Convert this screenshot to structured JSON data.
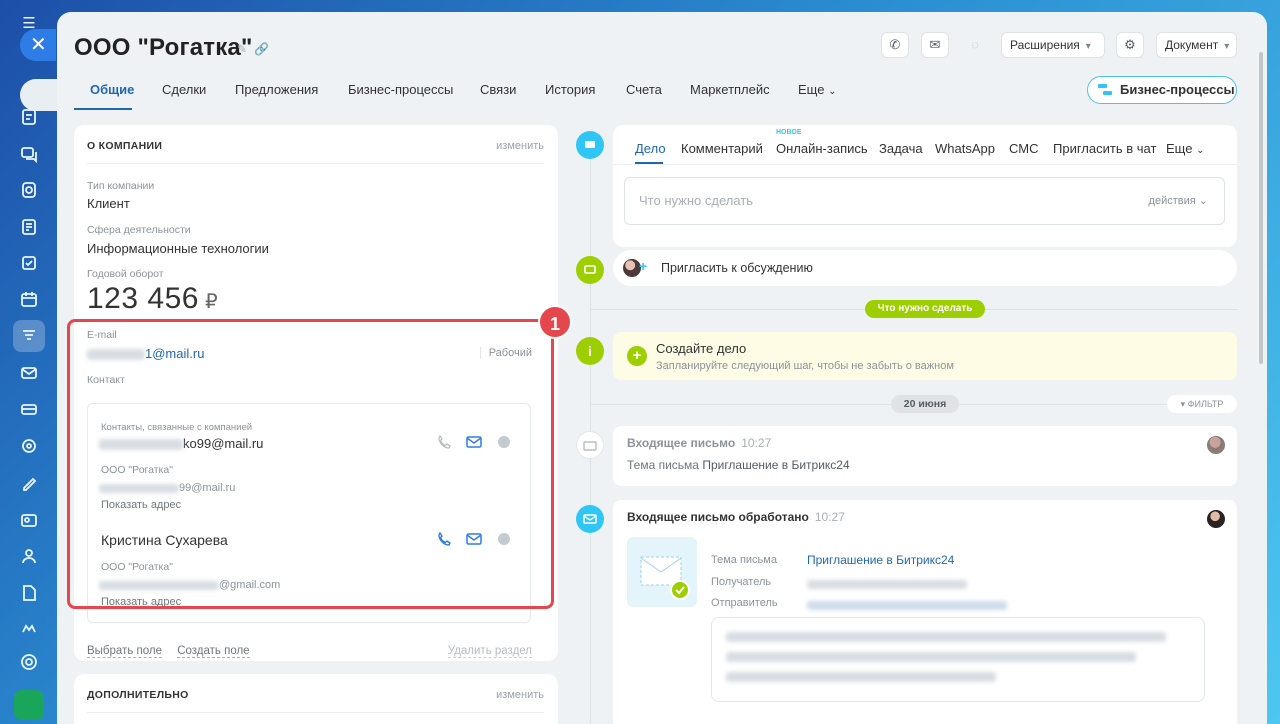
{
  "window": {
    "title": "ООО \"Рогатка\""
  },
  "header": {
    "extensions_label": "Расширения",
    "document_label": "Документ"
  },
  "tabs": [
    "Общие",
    "Сделки",
    "Предложения",
    "Бизнес-процессы",
    "Связи",
    "История",
    "Счета",
    "Маркетплейс",
    "Еще"
  ],
  "bp_button": "Бизнес-процессы",
  "about": {
    "section_title": "О КОМПАНИИ",
    "edit_label": "изменить",
    "company_type_label": "Тип компании",
    "company_type": "Клиент",
    "industry_label": "Сфера деятельности",
    "industry": "Информационные технологии",
    "revenue_label": "Годовой оборот",
    "revenue": "123 456",
    "currency": "₽",
    "email_label": "E-mail",
    "email_suffix": "1@mail.ru",
    "email_type": "Рабочий",
    "contact_label": "Контакт",
    "contacts_header": "Контакты, связанные с компанией",
    "contact1_email": "ko99@mail.ru",
    "contact1_company": "ООО \"Рогатка\"",
    "contact1_email2": "99@mail.ru",
    "contact1_address": "Показать адрес",
    "contact2_name": "Кристина Сухарева",
    "contact2_company": "ООО \"Рогатка\"",
    "contact2_email": "@gmail.com",
    "contact2_address": "Показать адрес",
    "select_field": "Выбрать поле",
    "create_field": "Создать поле",
    "delete_section": "Удалить раздел",
    "highlight_number": "1"
  },
  "extra": {
    "section_title": "ДОПОЛНИТЕЛЬНО",
    "edit_label": "изменить"
  },
  "editor": {
    "tabs": [
      "Дело",
      "Комментарий",
      "Онлайн-запись",
      "Задача",
      "WhatsApp",
      "СМС",
      "Пригласить в чат",
      "Еще"
    ],
    "new_tag": "НОВОЕ",
    "placeholder": "Что нужно сделать",
    "actions": "действия"
  },
  "timeline": {
    "invite": "Пригласить к обсуждению",
    "todo_pill": "Что нужно сделать",
    "create_title": "Создайте дело",
    "create_sub": "Запланируйте следующий шаг, чтобы не забыть о важном",
    "date": "20 июня",
    "filter": "ФИЛЬТР",
    "mail1_title": "Входящее письмо",
    "mail1_time": "10:27",
    "mail1_subject_label": "Тема письма",
    "mail1_subject": "Приглашение в Битрикс24",
    "mail2_title": "Входящее письмо обработано",
    "mail2_time": "10:27",
    "subject_label": "Тема письма",
    "subject_value": "Приглашение в Битрикс24",
    "recipient_label": "Получатель",
    "sender_label": "Отправитель"
  },
  "colors": {
    "accent": "#2067b0",
    "highlight": "#e5474d",
    "green": "#9dcf00",
    "cyan": "#2fc6f6"
  }
}
